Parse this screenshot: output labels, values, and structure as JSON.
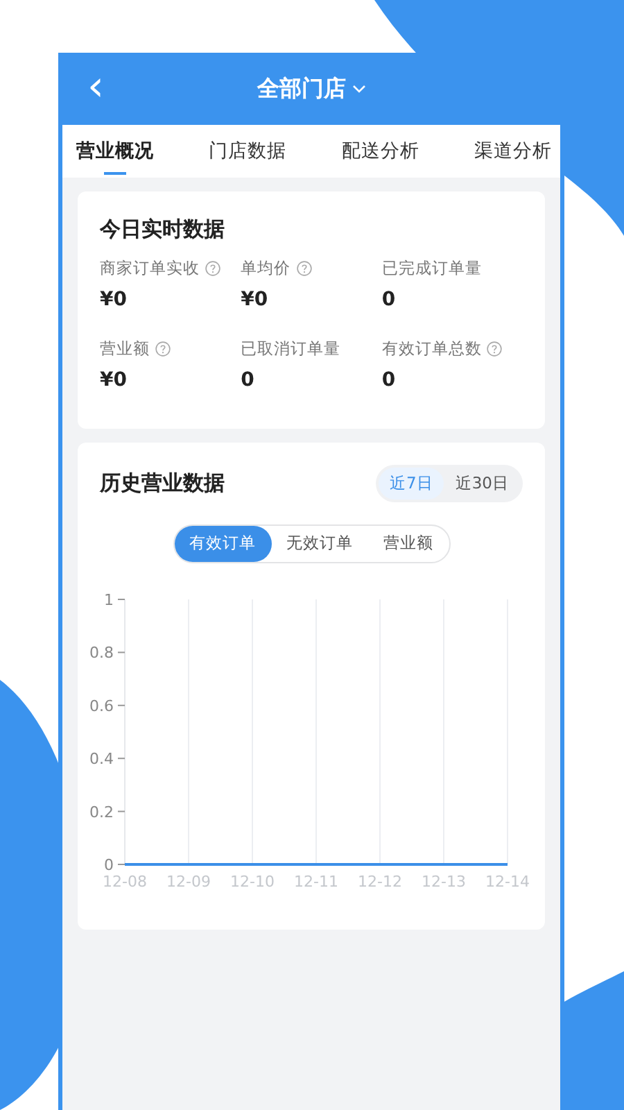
{
  "header": {
    "back_icon": "‹",
    "title": "全部门店"
  },
  "tabs": [
    {
      "label": "营业概况",
      "selected": true
    },
    {
      "label": "门店数据",
      "selected": false
    },
    {
      "label": "配送分析",
      "selected": false
    },
    {
      "label": "渠道分析",
      "selected": false
    }
  ],
  "today": {
    "title": "今日实时数据",
    "metrics": [
      {
        "label": "商家订单实收",
        "value": "¥0",
        "help": true
      },
      {
        "label": "单均价",
        "value": "¥0",
        "help": true
      },
      {
        "label": "已完成订单量",
        "value": "0",
        "help": false
      },
      {
        "label": "营业额",
        "value": "¥0",
        "help": true
      },
      {
        "label": "已取消订单量",
        "value": "0",
        "help": false
      },
      {
        "label": "有效订单总数",
        "value": "0",
        "help": true
      }
    ]
  },
  "history": {
    "title": "历史营业数据",
    "ranges": [
      {
        "label": "近7日",
        "selected": true
      },
      {
        "label": "近30日",
        "selected": false
      }
    ],
    "metrics": [
      {
        "label": "有效订单",
        "selected": true
      },
      {
        "label": "无效订单",
        "selected": false
      },
      {
        "label": "营业额",
        "selected": false
      }
    ],
    "chart_data": {
      "type": "line",
      "categories": [
        "12-08",
        "12-09",
        "12-10",
        "12-11",
        "12-12",
        "12-13",
        "12-14"
      ],
      "series": [
        {
          "color": "#3b8fe8",
          "values": [
            0,
            0,
            0,
            0,
            0,
            0,
            0
          ]
        }
      ],
      "grid": true,
      "ylim": [
        0,
        1
      ],
      "yticks": [
        {
          "value": 0,
          "label": "0"
        },
        {
          "value": 0.2,
          "label": "0.2"
        },
        {
          "value": 0.4,
          "label": "0.4"
        },
        {
          "value": 0.6,
          "label": "0.6"
        },
        {
          "value": 0.8,
          "label": "0.8"
        },
        {
          "value": 1,
          "label": "1"
        }
      ]
    }
  }
}
